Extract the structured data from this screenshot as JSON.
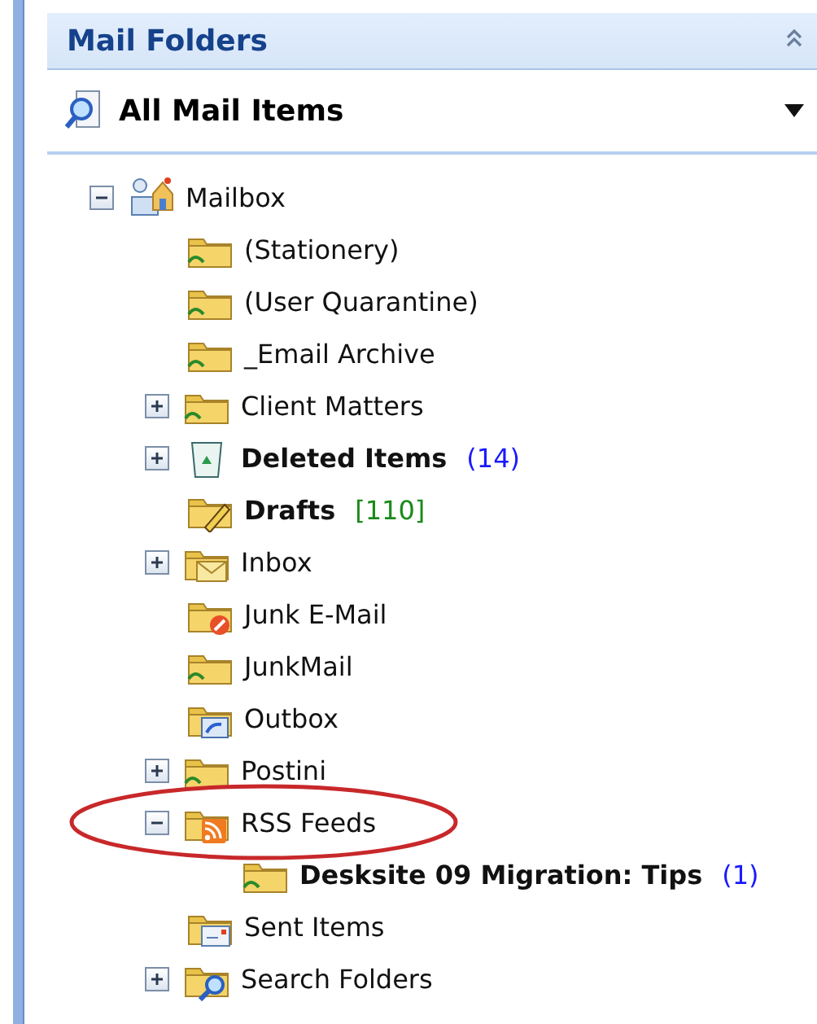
{
  "header": {
    "title": "Mail Folders"
  },
  "view_selector": {
    "label": "All Mail Items"
  },
  "tree": [
    {
      "label": "Mailbox",
      "kind": "mailbox",
      "expanded": true,
      "unread": false,
      "children": [
        {
          "label": "(Stationery)",
          "kind": "shared",
          "unread": false
        },
        {
          "label": "(User Quarantine)",
          "kind": "shared",
          "unread": false
        },
        {
          "label": "_Email Archive",
          "kind": "shared",
          "unread": false
        },
        {
          "label": "Client Matters",
          "kind": "shared",
          "expanded": false,
          "unread": false
        },
        {
          "label": "Deleted Items",
          "kind": "trash",
          "expanded": false,
          "unread": true,
          "count": "(14)",
          "color": "#1a1aff"
        },
        {
          "label": "Drafts",
          "kind": "drafts",
          "unread": true,
          "count": "[110]",
          "color": "#1a8a1a"
        },
        {
          "label": "Inbox",
          "kind": "inbox",
          "expanded": false,
          "unread": false
        },
        {
          "label": "Junk E-Mail",
          "kind": "junk",
          "unread": false
        },
        {
          "label": "JunkMail",
          "kind": "shared",
          "unread": false
        },
        {
          "label": "Outbox",
          "kind": "outbox",
          "unread": false
        },
        {
          "label": "Postini",
          "kind": "shared",
          "expanded": false,
          "unread": false
        },
        {
          "label": "RSS Feeds",
          "kind": "rss",
          "expanded": true,
          "circled": true,
          "unread": false,
          "children": [
            {
              "label": "Desksite 09 Migration: Tips",
              "kind": "shared",
              "unread": true,
              "count": "(1)",
              "color": "#1a1aff"
            }
          ]
        },
        {
          "label": "Sent Items",
          "kind": "sent",
          "unread": false
        },
        {
          "label": "Search Folders",
          "kind": "search",
          "expanded": false,
          "unread": false
        }
      ]
    }
  ]
}
